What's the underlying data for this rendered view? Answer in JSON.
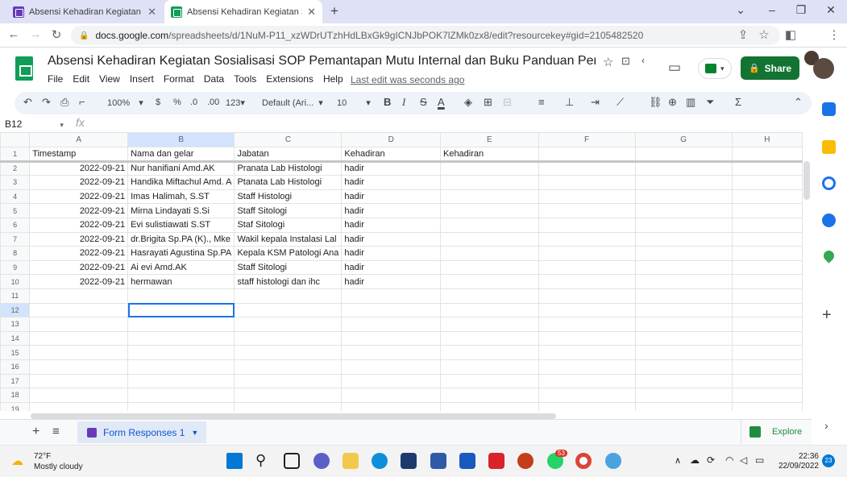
{
  "browser": {
    "tabs": [
      {
        "title": "Absensi Kehadiran Kegiatan Sosi",
        "icon": "forms-icon"
      },
      {
        "title": "Absensi Kehadiran Kegiatan Sosi",
        "icon": "sheets-icon",
        "active": true
      }
    ],
    "new_tab": "+",
    "url_domain": "docs.google.com",
    "url_path": "/spreadsheets/d/1NuM-P11_xzWDrUTzhHdLBxGk9gICNJbPOK7lZMk0zx8/edit?resourcekey#gid=2105482520"
  },
  "sheets": {
    "title": "Absensi Kehadiran Kegiatan Sosialisasi SOP Pemantapan Mutu Internal dan Buku Panduan Pemelihar...",
    "menu": [
      "File",
      "Edit",
      "View",
      "Insert",
      "Format",
      "Data",
      "Tools",
      "Extensions",
      "Help"
    ],
    "last_edit": "Last edit was seconds ago",
    "share_label": "Share",
    "toolbar": {
      "zoom": "100%",
      "currency": "$",
      "percent": "%",
      "dec_decrease": ".0",
      "dec_increase": ".00",
      "more_formats": "123",
      "font": "Default (Ari...",
      "font_size": "10",
      "bold": "B",
      "italic": "I",
      "strike": "S",
      "text_color": "A"
    },
    "name_box": "B12",
    "fx": "fx",
    "columns": [
      "A",
      "B",
      "C",
      "D",
      "E",
      "F",
      "G",
      "H"
    ],
    "rows": [
      [
        "Timestamp",
        "Nama dan gelar",
        "Jabatan",
        "Kehadiran",
        "Kehadiran",
        "",
        "",
        ""
      ],
      [
        "2022-09-21",
        "Nur hanifiani Amd.AK",
        "Pranata Lab Histologi",
        "hadir",
        "",
        "",
        "",
        ""
      ],
      [
        "2022-09-21",
        "Handika Miftachul Amd. A",
        "Ptanata Lab Histologi",
        "hadir",
        "",
        "",
        "",
        ""
      ],
      [
        "2022-09-21",
        "Imas Halimah, S.ST",
        "Staff Histologi",
        "hadir",
        "",
        "",
        "",
        ""
      ],
      [
        "2022-09-21",
        "Mirna Lindayati S.Si",
        "Staff Sitologi",
        "hadir",
        "",
        "",
        "",
        ""
      ],
      [
        "2022-09-21",
        "Evi sulistiawati S.ST",
        "Staf Sitologi",
        "hadir",
        "",
        "",
        "",
        ""
      ],
      [
        "2022-09-21",
        "dr.Brigita Sp.PA (K)., Mke",
        "Wakil kepala Instalasi Lal",
        "hadir",
        "",
        "",
        "",
        ""
      ],
      [
        "2022-09-21",
        "Hasrayati Agustina Sp.PA",
        "Kepala KSM Patologi Ana",
        "hadir",
        "",
        "",
        "",
        ""
      ],
      [
        "2022-09-21",
        "Ai evi Amd.AK",
        "Staff Sitologi",
        "hadir",
        "",
        "",
        "",
        ""
      ],
      [
        "2022-09-21",
        "hermawan",
        "staff histologi dan ihc",
        "hadir",
        "",
        "",
        "",
        ""
      ],
      [
        "",
        "",
        "",
        "",
        "",
        "",
        "",
        ""
      ],
      [
        "",
        "",
        "",
        "",
        "",
        "",
        "",
        ""
      ],
      [
        "",
        "",
        "",
        "",
        "",
        "",
        "",
        ""
      ],
      [
        "",
        "",
        "",
        "",
        "",
        "",
        "",
        ""
      ],
      [
        "",
        "",
        "",
        "",
        "",
        "",
        "",
        ""
      ],
      [
        "",
        "",
        "",
        "",
        "",
        "",
        "",
        ""
      ],
      [
        "",
        "",
        "",
        "",
        "",
        "",
        "",
        ""
      ],
      [
        "",
        "",
        "",
        "",
        "",
        "",
        "",
        ""
      ],
      [
        "",
        "",
        "",
        "",
        "",
        "",
        "",
        ""
      ]
    ],
    "sheet_tab": "Form Responses 1",
    "explore": "Explore"
  },
  "taskbar": {
    "temp": "72°F",
    "condition": "Mostly cloudy",
    "time": "22:36",
    "date": "22/09/2022",
    "notif_count": "23",
    "whatsapp_badge": "53"
  },
  "colors": {
    "accent": "#1a73e8",
    "share": "#137333",
    "tabstrip": "#dfe1f6"
  }
}
